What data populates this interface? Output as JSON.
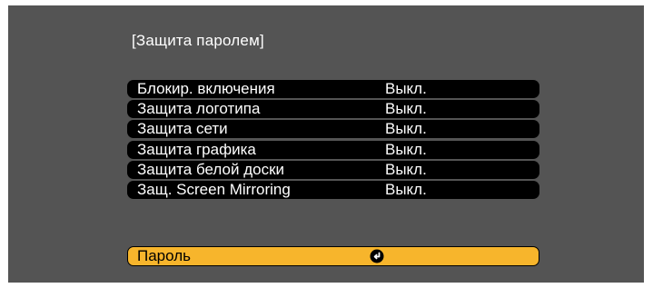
{
  "menu": {
    "title": "[Защита паролем]",
    "settings": [
      {
        "label": "Блокир. включения",
        "value": "Выкл."
      },
      {
        "label": "Защита логотипа",
        "value": "Выкл."
      },
      {
        "label": "Защита сети",
        "value": "Выкл."
      },
      {
        "label": "Защита графика",
        "value": "Выкл."
      },
      {
        "label": "Защита белой доски",
        "value": "Выкл."
      },
      {
        "label": "Защ. Screen Mirroring",
        "value": "Выкл."
      }
    ],
    "password": {
      "label": "Пароль",
      "icon": "enter-icon"
    }
  },
  "colors": {
    "screen_background": "#545454",
    "row_background": "#000000",
    "highlight": "#f7b52c",
    "text": "#ffffff"
  }
}
